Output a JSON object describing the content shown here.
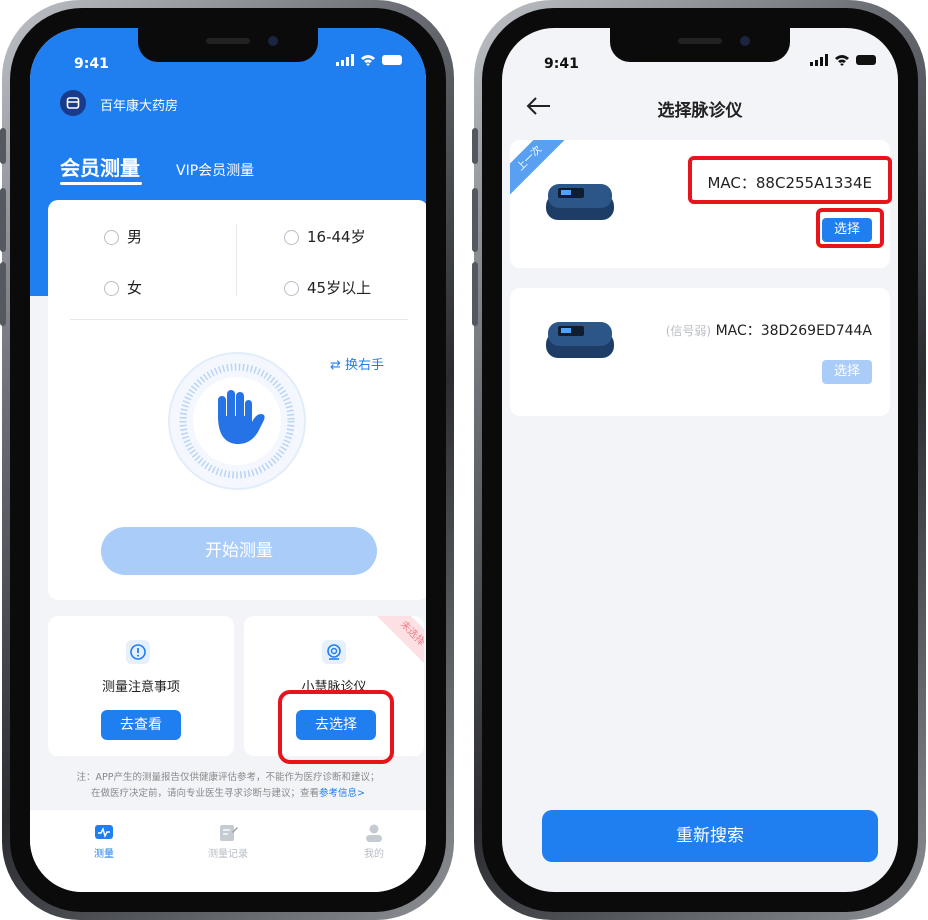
{
  "status_time": "9:41",
  "left": {
    "store_name": "百年康大药房",
    "tabs": [
      "会员测量",
      "VIP会员测量"
    ],
    "gender_options": [
      "男",
      "女"
    ],
    "age_options": [
      "16-44岁",
      "45岁以上"
    ],
    "switch_hand": "换右手",
    "start_button": "开始测量",
    "tip_card": {
      "title": "测量注意事项",
      "button": "去查看"
    },
    "device_card": {
      "title": "小慧脉诊仪",
      "button": "去选择",
      "ribbon": "未选择"
    },
    "disclaimer_line1": "注：APP产生的测量报告仅供健康评估参考，不能作为医疗诊断和建议；",
    "disclaimer_line2": "在做医疗决定前，请向专业医生寻求诊断与建议；查看",
    "disclaimer_link": "参考信息>",
    "tabbar": [
      "测量",
      "测量记录",
      "我的"
    ]
  },
  "right": {
    "title": "选择脉诊仪",
    "devices": [
      {
        "ribbon": "上一次",
        "prefix": "",
        "mac": "MAC：88C255A1334E",
        "button": "选择"
      },
      {
        "ribbon": "",
        "prefix": "(信号弱)",
        "mac": "MAC：38D269ED744A",
        "button": "选择"
      }
    ],
    "research_button": "重新搜索"
  },
  "colors": {
    "primary": "#1f7ff0",
    "highlight": "#e8141c",
    "disabled": "#a9cdf8"
  }
}
